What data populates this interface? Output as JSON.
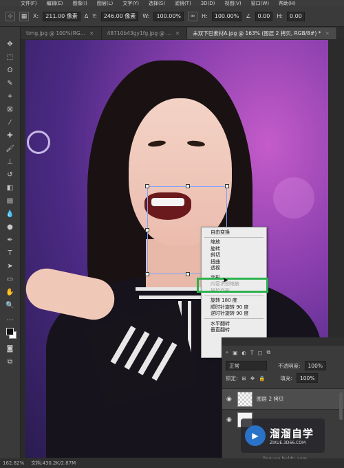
{
  "menubar": {
    "items": [
      "文件(F)",
      "编辑(E)",
      "图像(I)",
      "图层(L)",
      "文字(Y)",
      "选择(S)",
      "滤镜(T)",
      "3D(D)",
      "视图(V)",
      "窗口(W)",
      "帮助(H)"
    ]
  },
  "options": {
    "x_label": "X:",
    "x_value": "211.00 像素",
    "y_label": "Y:",
    "y_value": "246.00 像素",
    "w_label": "W:",
    "w_value": "100.00%",
    "h_label": "H:",
    "h_value": "100.00%",
    "angle_value": "0.00",
    "h2_label": "H:",
    "h2_value": "0.00"
  },
  "tabs": [
    {
      "label": "timg.jpg @ 100%(RG...",
      "active": false
    },
    {
      "label": "48710b43gy1fg.jpg @ ...",
      "active": false
    },
    {
      "label": "未双下巴素材A.jpg @ 163% (图层 2 拷贝, RGB/8#) *",
      "active": true
    }
  ],
  "context_menu": {
    "items": [
      {
        "label": "自由变换",
        "disabled": false
      },
      {
        "label": "缩放",
        "disabled": false
      },
      {
        "label": "旋转",
        "disabled": false
      },
      {
        "label": "斜切",
        "disabled": false
      },
      {
        "label": "扭曲",
        "disabled": false
      },
      {
        "label": "透视",
        "disabled": false
      },
      {
        "label": "变形",
        "disabled": false
      },
      {
        "label": "内容识别缩放",
        "disabled": true
      },
      {
        "label": "操控变形",
        "disabled": true
      },
      {
        "label": "旋转 180 度",
        "disabled": false
      },
      {
        "label": "顺时针旋转 90 度",
        "disabled": false
      },
      {
        "label": "逆时针旋转 90 度",
        "disabled": false
      },
      {
        "label": "水平翻转",
        "disabled": false
      },
      {
        "label": "垂直翻转",
        "disabled": false
      }
    ],
    "highlight_color": "#2bb24c"
  },
  "layers_panel": {
    "blend_mode": "正常",
    "opacity_label": "不透明度:",
    "opacity_value": "100%",
    "lock_label": "锁定:",
    "fill_label": "填充:",
    "fill_value": "100%",
    "layers": [
      {
        "name": "图层 2 拷贝",
        "active": true
      },
      {
        "name": "",
        "active": false
      }
    ]
  },
  "watermark": {
    "cn": "溜溜自学",
    "en": "ZIXUE.3D66.COM",
    "url": "jingyan.baidu.com"
  },
  "status": {
    "zoom": "162.82%",
    "doc": "文档:430.2K/2.87M"
  }
}
